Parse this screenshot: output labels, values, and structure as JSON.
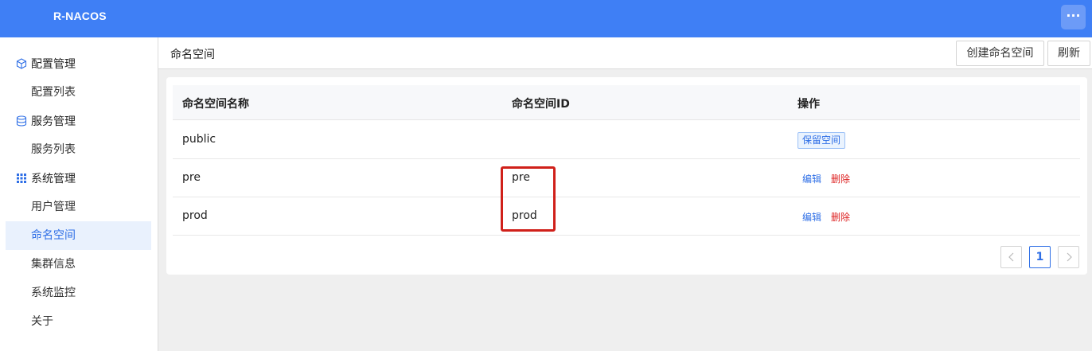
{
  "app": {
    "title": "R-NACOS",
    "more_label": "···"
  },
  "sidebar": {
    "groups": [
      {
        "label": "配置管理",
        "icon": "cube-icon",
        "items": [
          {
            "label": "配置列表"
          }
        ]
      },
      {
        "label": "服务管理",
        "icon": "database-icon",
        "items": [
          {
            "label": "服务列表"
          }
        ]
      },
      {
        "label": "系统管理",
        "icon": "grid-icon",
        "items": [
          {
            "label": "用户管理"
          },
          {
            "label": "命名空间",
            "active": true
          },
          {
            "label": "集群信息"
          },
          {
            "label": "系统监控"
          },
          {
            "label": "关于"
          }
        ]
      }
    ]
  },
  "header": {
    "title": "命名空间",
    "create_label": "创建命名空间",
    "refresh_label": "刷新"
  },
  "table": {
    "columns": [
      "命名空间名称",
      "命名空间ID",
      "操作"
    ],
    "rows": [
      {
        "name": "public",
        "id": "",
        "tag": "保留空间"
      },
      {
        "name": "pre",
        "id": "pre",
        "edit": "编辑",
        "delete": "删除"
      },
      {
        "name": "prod",
        "id": "prod",
        "edit": "编辑",
        "delete": "删除"
      }
    ]
  },
  "pagination": {
    "current_page": "1"
  },
  "colors": {
    "brand": "#3f7ff5",
    "accent": "#2f6fe6",
    "danger": "#d22",
    "highlight_box": "#d0201a"
  }
}
